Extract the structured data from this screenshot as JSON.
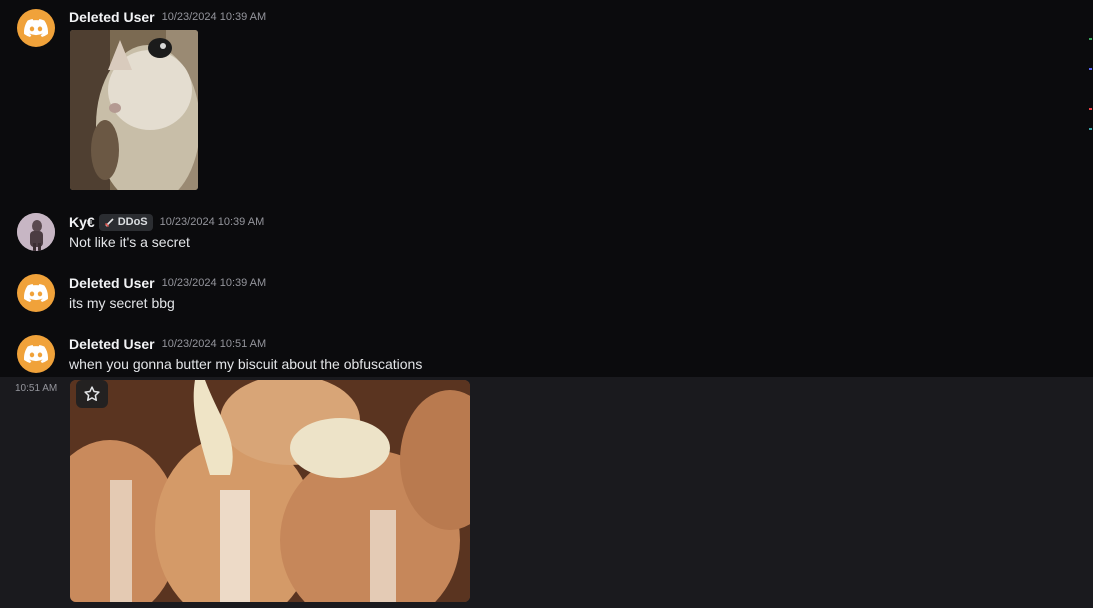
{
  "messages": [
    {
      "username": "Deleted User",
      "timestamp": "10/23/2024 10:39 AM",
      "text": "",
      "avatar": "discord-logo-icon"
    },
    {
      "username": "Ky€",
      "role_tag": "DDoS",
      "timestamp": "10/23/2024 10:39 AM",
      "text": "Not like it's a secret",
      "avatar": "user-avatar"
    },
    {
      "username": "Deleted User",
      "timestamp": "10/23/2024 10:39 AM",
      "text": "its my secret bbg",
      "avatar": "discord-logo-icon"
    },
    {
      "username": "Deleted User",
      "timestamp": "10/23/2024 10:51 AM",
      "text": "when you gonna butter my biscuit about the obfuscations",
      "avatar": "discord-logo-icon"
    }
  ],
  "hover_timestamp": "10:51 AM",
  "colors": {
    "background": "#0b0b0d",
    "hover_row": "#1a1a1e",
    "discord_avatar": "#f0a23a",
    "username": "#f2f3f5",
    "timestamp": "#94959c",
    "text": "#e3e5e8"
  },
  "icons": {
    "favorite": "star-icon",
    "role": "sword-icon"
  }
}
